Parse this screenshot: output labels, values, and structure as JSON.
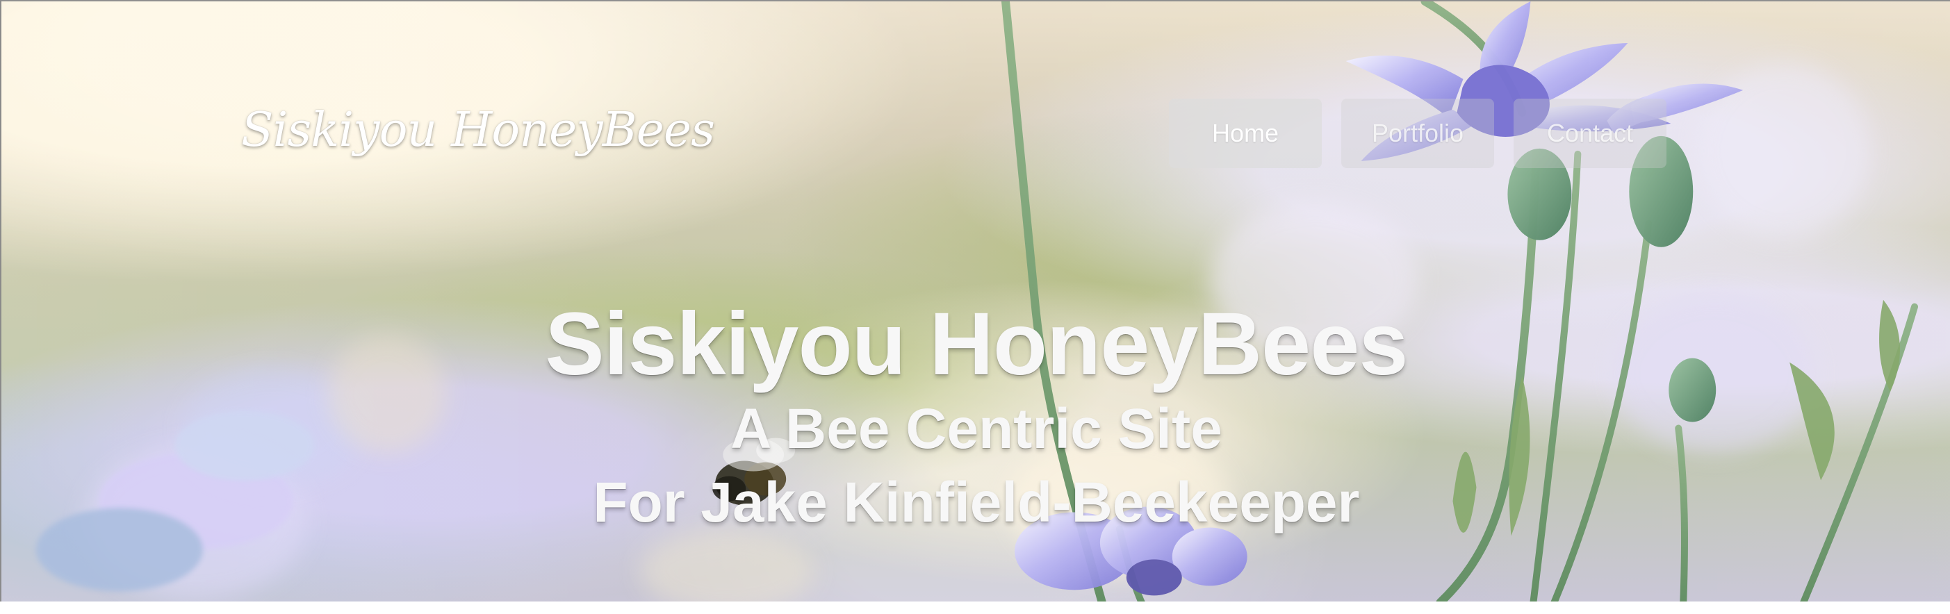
{
  "header": {
    "logo": "Siskiyou HoneyBees",
    "nav": [
      "Home",
      "Portfolio",
      "Contact"
    ]
  },
  "hero": {
    "title": "Siskiyou HoneyBees",
    "subtitle_1": "A Bee Centric Site",
    "subtitle_2": "For Jake Kinfield-Beekeeper"
  },
  "colors": {
    "text": "#f7f7f7",
    "nav_active_bg": "#dcdcdc",
    "nav_soft_bg": "#cdcdcd",
    "flower_accent": "#9389d8",
    "stem_green": "#7fa27a"
  },
  "icons": {
    "flower_petals": "cornflower-illustration",
    "bee": "bee-illustration"
  }
}
